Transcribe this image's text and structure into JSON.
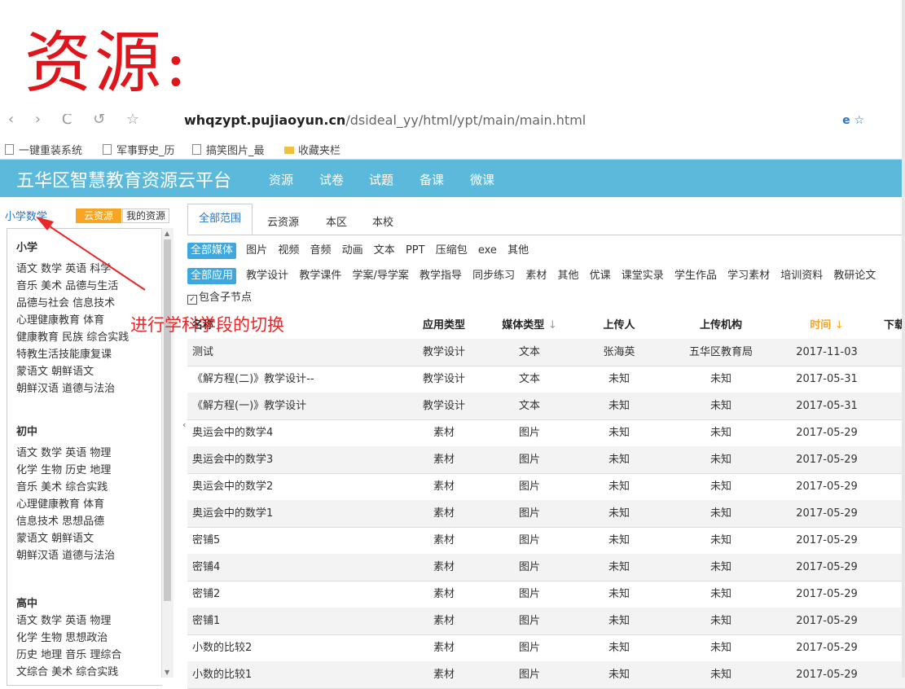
{
  "annotation": {
    "title": "资源:",
    "note": "进行学科学段的切换"
  },
  "browser": {
    "nav_glyphs": "‹ › C ↺ ☆",
    "url_bold": "whqzypt.pujiaoyun.cn",
    "url_rest": "/dsideal_yy/html/ypt/main/main.html",
    "ie_badge": "e ☆",
    "bookmarks": [
      "一键重装系统",
      "军事野史_历",
      "搞笑图片_最",
      "收藏夹栏"
    ]
  },
  "header": {
    "title": "五华区智慧教育资源云平台",
    "nav": [
      "资源",
      "试卷",
      "试题",
      "备课",
      "微课"
    ]
  },
  "sidebar": {
    "current_subject": "小学数学",
    "cloud_label": "云资源",
    "mine_label": "我的资源",
    "stages": [
      {
        "name": "小学",
        "lines": [
          "语文  数学  英语  科学",
          "音乐  美术  品德与生活",
          "品德与社会  信息技术",
          "心理健康教育  体育",
          "健康教育  民族  综合实践",
          "特教生活技能康复课",
          "蒙语文  朝鲜语文",
          "朝鲜汉语  道德与法治"
        ]
      },
      {
        "name": "初中",
        "lines": [
          "语文  数学  英语  物理",
          "化学  生物  历史  地理",
          "音乐  美术  综合实践",
          "心理健康教育  体育",
          "信息技术  思想品德",
          "蒙语文  朝鲜语文",
          "朝鲜汉语  道德与法治"
        ]
      },
      {
        "name": "高中",
        "lines": [
          "语文  数学  英语  物理",
          "化学  生物  思想政治",
          "历史  地理  音乐  理综合",
          "文综合  美术  综合实践"
        ]
      }
    ]
  },
  "tabs": [
    "全部范围",
    "云资源",
    "本区",
    "本校"
  ],
  "media_filter": {
    "active": "全部媒体",
    "items": [
      "图片",
      "视频",
      "音频",
      "动画",
      "文本",
      "PPT",
      "压缩包",
      "exe",
      "其他"
    ]
  },
  "app_filter": {
    "active": "全部应用",
    "items": [
      "教学设计",
      "教学课件",
      "学案/导学案",
      "教学指导",
      "同步练习",
      "素材",
      "其他",
      "优课",
      "课堂实录",
      "学生作品",
      "学习素材",
      "培训资料",
      "教研论文"
    ]
  },
  "include_sub": "包含子节点",
  "table": {
    "headers": {
      "name": "名称",
      "app": "应用类型",
      "media": "媒体类型",
      "uploader": "上传人",
      "org": "上传机构",
      "time": "时间",
      "download": "下载"
    },
    "sort_glyph": "↓",
    "rows": [
      [
        "测试",
        "教学设计",
        "文本",
        "张海英",
        "五华区教育局",
        "2017-11-03"
      ],
      [
        "《解方程(二)》教学设计--",
        "教学设计",
        "文本",
        "未知",
        "未知",
        "2017-05-31"
      ],
      [
        "《解方程(一)》教学设计",
        "教学设计",
        "文本",
        "未知",
        "未知",
        "2017-05-31"
      ],
      [
        "奥运会中的数学4",
        "素材",
        "图片",
        "未知",
        "未知",
        "2017-05-29"
      ],
      [
        "奥运会中的数学3",
        "素材",
        "图片",
        "未知",
        "未知",
        "2017-05-29"
      ],
      [
        "奥运会中的数学2",
        "素材",
        "图片",
        "未知",
        "未知",
        "2017-05-29"
      ],
      [
        "奥运会中的数学1",
        "素材",
        "图片",
        "未知",
        "未知",
        "2017-05-29"
      ],
      [
        "密铺5",
        "素材",
        "图片",
        "未知",
        "未知",
        "2017-05-29"
      ],
      [
        "密铺4",
        "素材",
        "图片",
        "未知",
        "未知",
        "2017-05-29"
      ],
      [
        "密铺2",
        "素材",
        "图片",
        "未知",
        "未知",
        "2017-05-29"
      ],
      [
        "密铺1",
        "素材",
        "图片",
        "未知",
        "未知",
        "2017-05-29"
      ],
      [
        "小数的比较2",
        "素材",
        "图片",
        "未知",
        "未知",
        "2017-05-29"
      ],
      [
        "小数的比较1",
        "素材",
        "图片",
        "未知",
        "未知",
        "2017-05-29"
      ]
    ]
  }
}
